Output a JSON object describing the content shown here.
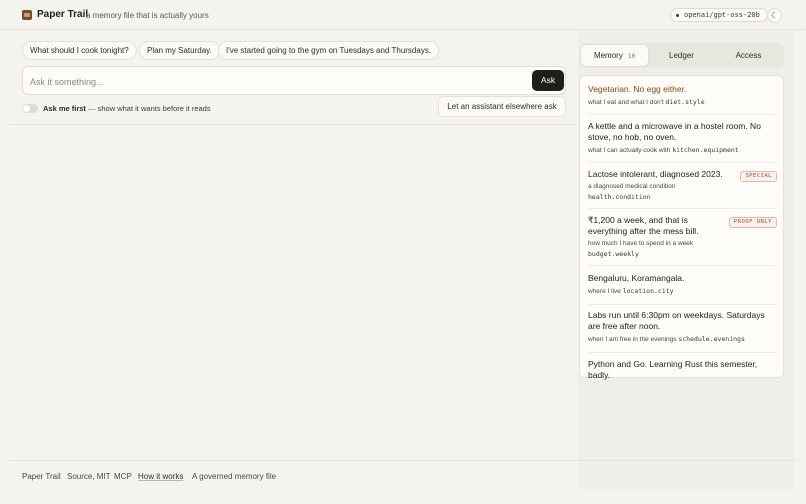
{
  "header": {
    "brand": "Paper Trail",
    "tagline": "a memory file that is actually yours",
    "model": "openai/gpt-oss-20b",
    "theme_icon": "moon-icon"
  },
  "suggestions": [
    "What should I cook tonight?",
    "Plan my Saturday.",
    "I've started going to the gym on Tuesdays and Thursdays."
  ],
  "ask": {
    "placeholder": "Ask it something...",
    "button": "Ask"
  },
  "toggle": {
    "label_bold": "Ask me first",
    "label_rest": "show what it wants before it reads",
    "separator": "—",
    "on": false
  },
  "assistant_button": "Let an assistant elsewhere ask",
  "panel": {
    "tabs": [
      {
        "label": "Memory",
        "count": "10"
      },
      {
        "label": "Ledger"
      },
      {
        "label": "Access"
      }
    ],
    "memories": [
      {
        "value": "Vegetarian. No egg either.",
        "meta": "what I eat and what I don't",
        "key": "diet.style"
      },
      {
        "value": "A kettle and a microwave in a hostel room. No stove, no hob, no oven.",
        "meta": "what I can actually cook with",
        "key": "kitchen.equipment"
      },
      {
        "value": "Lactose intolerant, diagnosed 2023.",
        "meta": "a diagnosed medical condition",
        "key": "health.condition",
        "tag": "SPECIAL"
      },
      {
        "value": "₹1,200 a week, and that is everything after the mess bill.",
        "meta": "how much I have to spend in a week",
        "key": "budget.weekly",
        "tag": "PROOF ONLY"
      },
      {
        "value": "Bengaluru, Koramangala.",
        "meta": "where I live",
        "key": "location.city"
      },
      {
        "value": "Labs run until 6:30pm on weekdays. Saturdays are free after noon.",
        "meta": "when I am free in the evenings",
        "key": "schedule.evenings"
      },
      {
        "value": "Python and Go. Learning Rust this semester, badly."
      }
    ]
  },
  "footer": {
    "brand": "Paper Trail",
    "source": "Source, MIT",
    "mcp": "MCP",
    "how": "How it works",
    "note": "A governed memory file"
  },
  "colors": {
    "accent": "#8a4a10",
    "button_dark": "#1e1e1c",
    "tag_red": "#a04a36",
    "background": "#f4f3ee"
  }
}
